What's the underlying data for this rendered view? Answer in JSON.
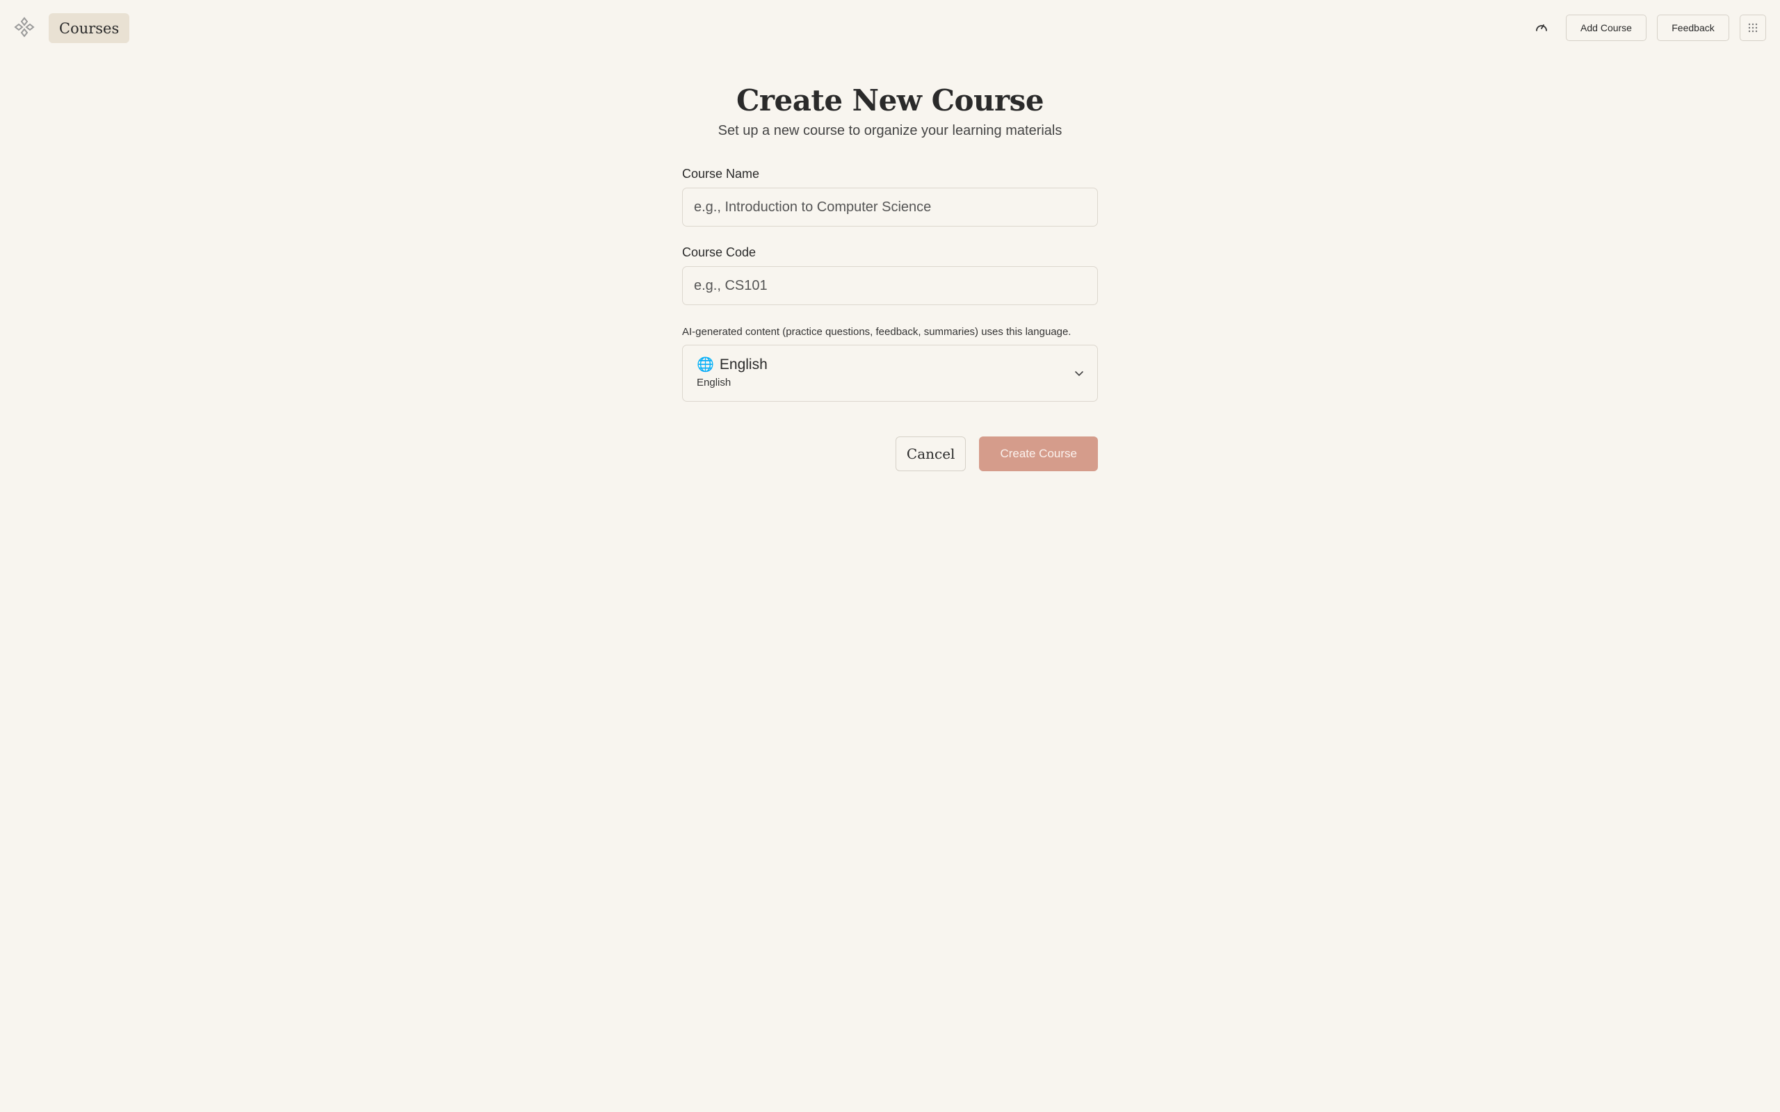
{
  "header": {
    "logo_icon": "diamond-nodes-icon",
    "courses_label": "Courses",
    "progress_icon": "gauge-icon",
    "add_course_label": "Add Course",
    "feedback_label": "Feedback",
    "apps_icon": "grid-dots-icon"
  },
  "form": {
    "title": "Create New Course",
    "subtitle": "Set up a new course to organize your learning materials",
    "course_name": {
      "label": "Course Name",
      "value": "",
      "placeholder": "e.g., Introduction to Computer Science"
    },
    "course_code": {
      "label": "Course Code",
      "value": "",
      "placeholder": "e.g., CS101"
    },
    "language": {
      "note": "AI-generated content (practice questions, feedback, summaries) uses this language.",
      "icon": "globe-icon",
      "selected_label": "English",
      "selected_native": "English"
    },
    "cancel_label": "Cancel",
    "create_label": "Create Course"
  },
  "colors": {
    "background": "#f8f5ef",
    "primary_button": "#d59c8b",
    "courses_pill": "#e9e1d3"
  }
}
